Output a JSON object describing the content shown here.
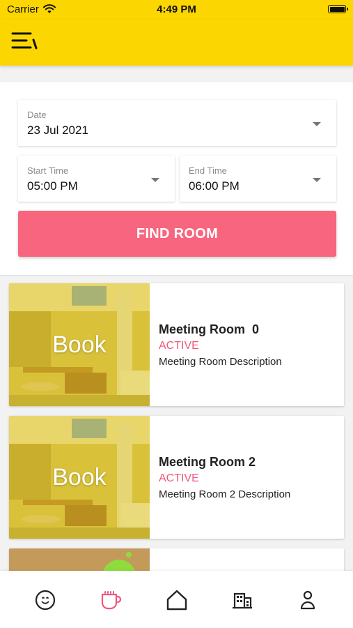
{
  "status_bar": {
    "carrier": "Carrier",
    "time": "4:49 PM"
  },
  "colors": {
    "brand_yellow": "#fcd600",
    "accent_pink": "#f7657e",
    "status_active": "#f0567a"
  },
  "appbar": {
    "menu_icon": "menu-icon"
  },
  "search_form": {
    "date": {
      "label": "Date",
      "value": "23 Jul 2021"
    },
    "start_time": {
      "label": "Start Time",
      "value": "05:00 PM"
    },
    "end_time": {
      "label": "End Time",
      "value": "06:00 PM"
    },
    "find_button_label": "FIND ROOM"
  },
  "rooms": [
    {
      "book_label": "Book",
      "name": "Meeting Room  0",
      "status": "ACTIVE",
      "description": "Meeting Room Description"
    },
    {
      "book_label": "Book",
      "name": "Meeting Room 2",
      "status": "ACTIVE",
      "description": "Meeting Room 2 Description"
    }
  ],
  "tab_bar": {
    "items": [
      {
        "icon": "smiley-face-icon",
        "active": false
      },
      {
        "icon": "coffee-cup-icon",
        "active": true
      },
      {
        "icon": "home-icon",
        "active": false
      },
      {
        "icon": "building-icon",
        "active": false
      },
      {
        "icon": "user-profile-icon",
        "active": false
      }
    ]
  }
}
